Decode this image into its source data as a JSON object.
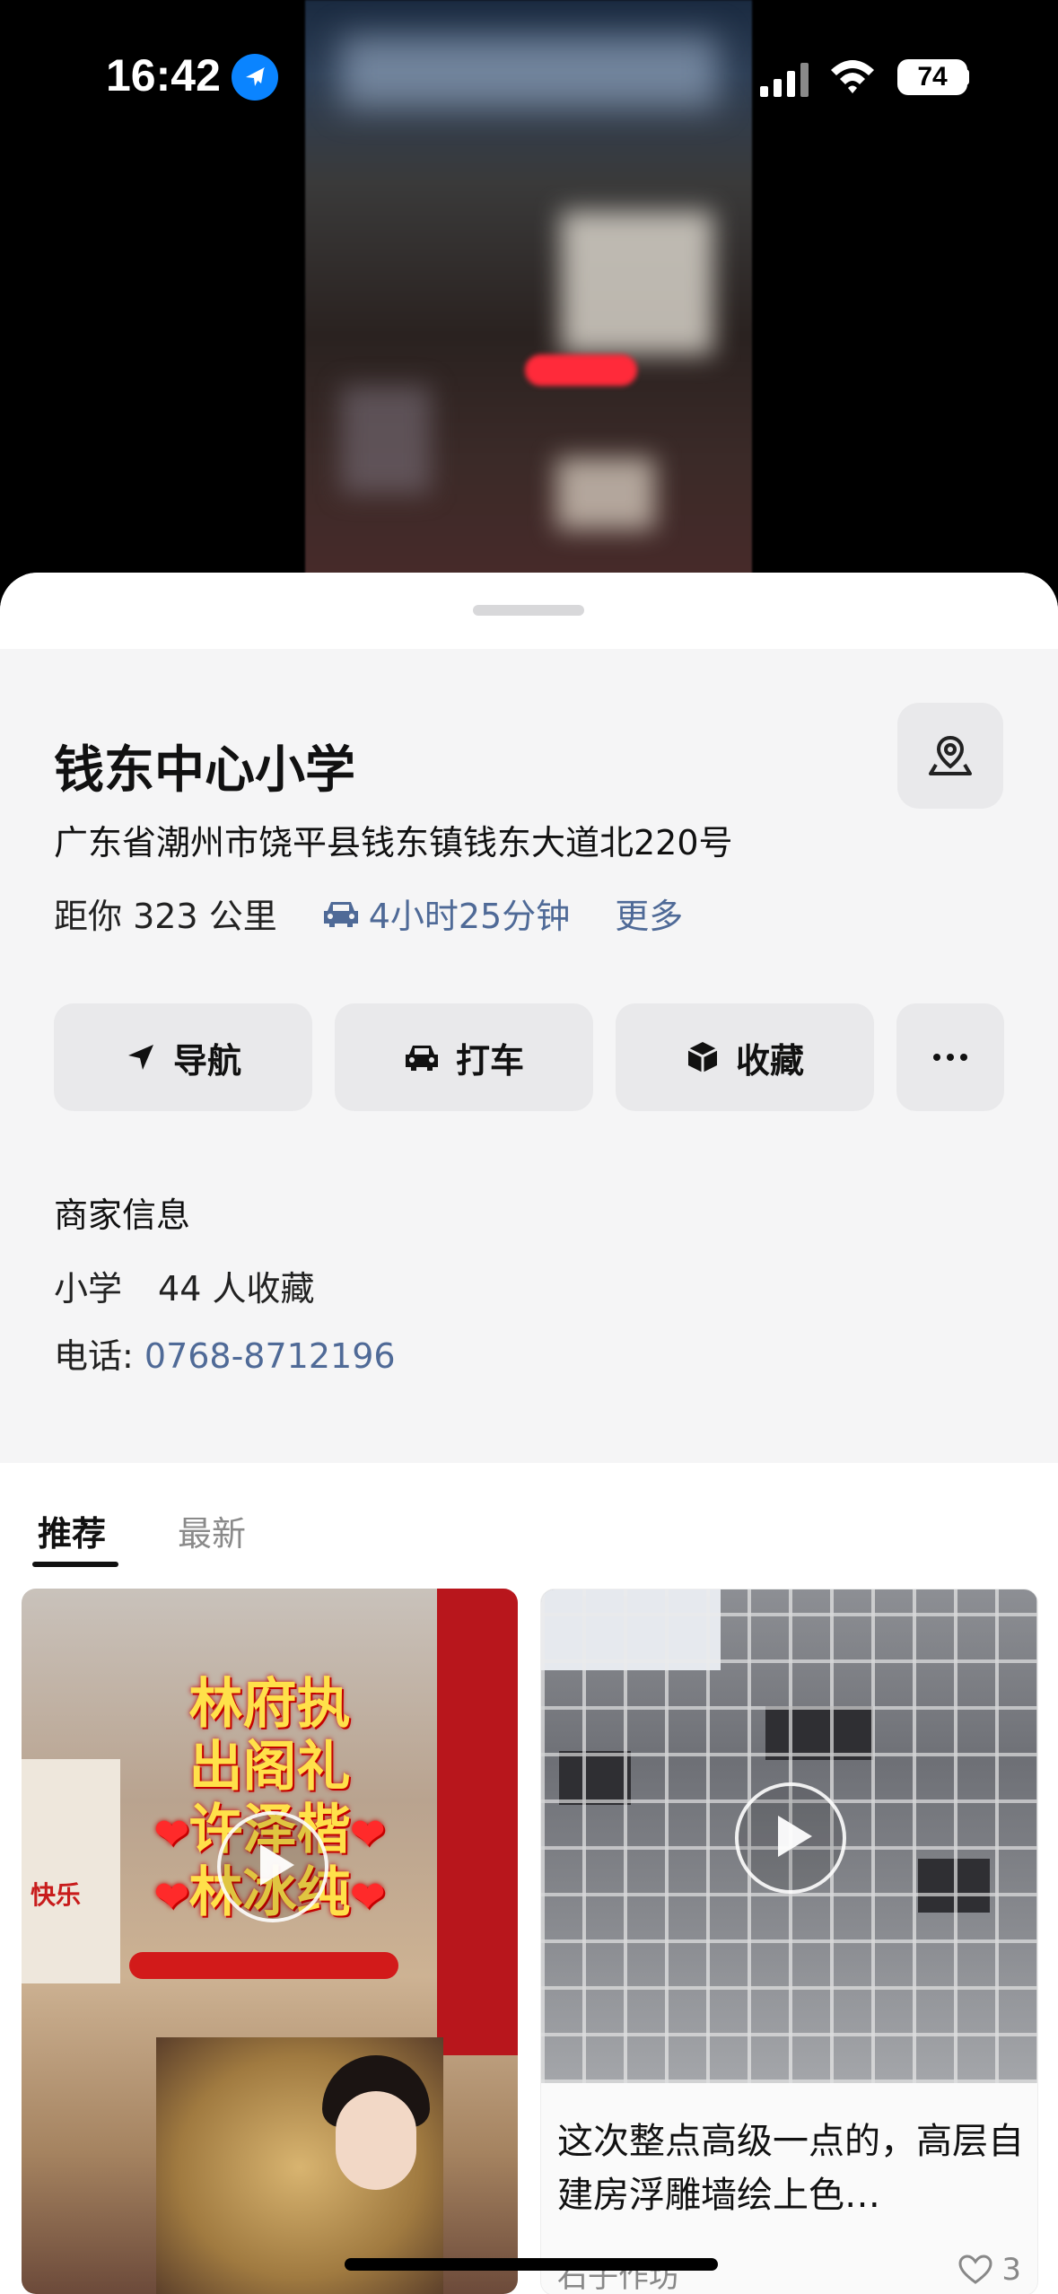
{
  "status_bar": {
    "time": "16:42",
    "battery": "74"
  },
  "place": {
    "name": "钱东中心小学",
    "address": "广东省潮州市饶平县钱东镇钱东大道北220号",
    "distance": "距你 323 公里",
    "drive_time": "4小时25分钟",
    "more": "更多"
  },
  "actions": {
    "navigate": "导航",
    "taxi": "打车",
    "favorite": "收藏"
  },
  "merchant": {
    "heading": "商家信息",
    "category": "小学",
    "favorites": "44 人收藏",
    "phone_label": "电话: ",
    "phone": "0768-8712196"
  },
  "feed": {
    "tabs": [
      "推荐",
      "最新"
    ],
    "cards": [
      {
        "overlay_lines": [
          "林府执",
          "出阁礼",
          "许泽楷",
          "林冰纯"
        ],
        "sign_text": "快乐"
      },
      {
        "title": "这次整点高级一点的，高层自建房浮雕墙绘上色…",
        "author": "石子作坊",
        "likes": "3"
      }
    ]
  }
}
